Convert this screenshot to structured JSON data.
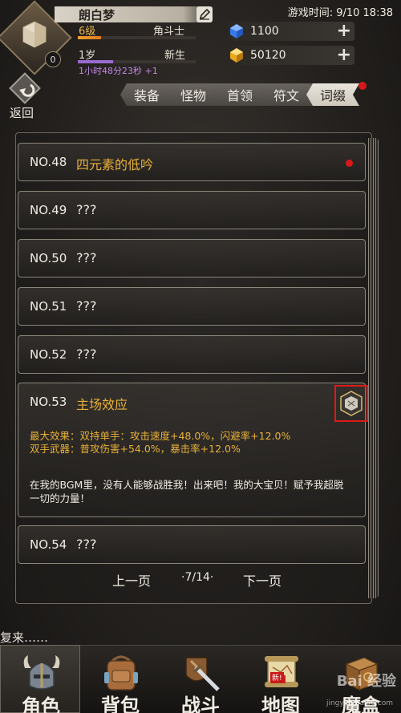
{
  "header": {
    "player_name": "朗白梦",
    "level_text": "6级",
    "class_text": "角斗士",
    "level_progress": 0.2,
    "age_text": "1岁",
    "age_tag": "新生",
    "age_progress": 0.3,
    "time_text": "1小时48分23秒 +1",
    "avatar_badge": "0",
    "game_time": "游戏时间: 9/10 18:38"
  },
  "currencies": [
    {
      "value": "1100",
      "icon": "blue-gem-icon"
    },
    {
      "value": "50120",
      "icon": "gold-gem-icon"
    }
  ],
  "back_label": "返回",
  "tabs": [
    {
      "label": "装备",
      "active": false
    },
    {
      "label": "怪物",
      "active": false
    },
    {
      "label": "首领",
      "active": false
    },
    {
      "label": "符文",
      "active": false
    },
    {
      "label": "词缀",
      "active": true
    }
  ],
  "entries": [
    {
      "no": "NO.48",
      "name": "四元素的低吟"
    },
    {
      "no": "NO.49",
      "name": "???"
    },
    {
      "no": "NO.50",
      "name": "???"
    },
    {
      "no": "NO.51",
      "name": "???"
    },
    {
      "no": "NO.52",
      "name": "???"
    },
    {
      "no": "NO.53",
      "name": "主场效应",
      "effect1": "最大效果：双持单手：攻击速度+48.0%，闪避率+12.0%",
      "effect2": "双手武器：普攻伤害+54.0%，暴击率+12.0%",
      "desc": "在我的BGM里，没有人能够战胜我！出来吧！我的大宝贝！赋予我超脱一切的力量！"
    },
    {
      "no": "NO.54",
      "name": "???"
    }
  ],
  "pager": {
    "prev": "上一页",
    "page": "·7/14·",
    "next": "下一页"
  },
  "ticker": "复来……",
  "nav": [
    {
      "label": "角色",
      "active": true
    },
    {
      "label": "背包",
      "active": false
    },
    {
      "label": "战斗",
      "active": false
    },
    {
      "label": "地图",
      "active": false,
      "badge": "新!"
    },
    {
      "label": "魔盒",
      "active": false
    }
  ],
  "watermark": "Bai 经验",
  "watermark_url": "jingyan.baidu.com",
  "colors": {
    "accent_gold": "#e8b038",
    "alert_red": "#d81818",
    "exp_bar": "#f0a030",
    "age_bar": "#9a6ad0"
  }
}
